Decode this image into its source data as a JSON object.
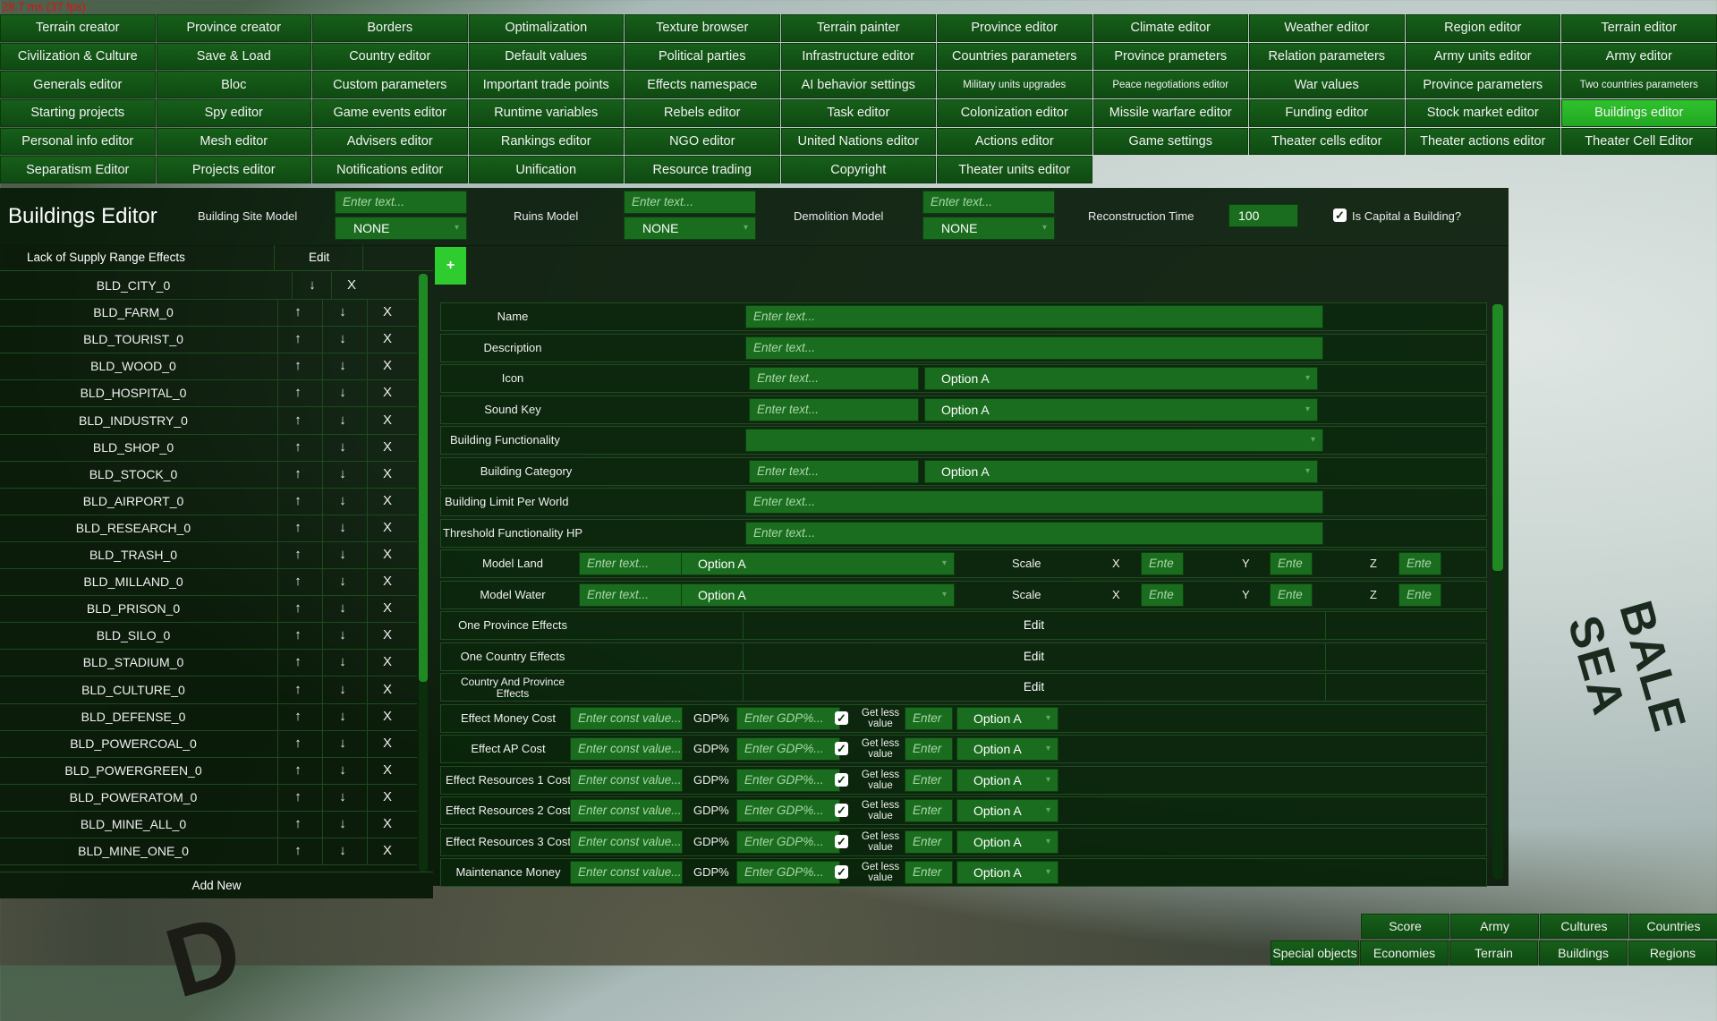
{
  "fps": "28.7 ms (37 fps)",
  "menu": [
    [
      "Terrain creator",
      "Province creator",
      "Borders",
      "Optimalization",
      "Texture browser",
      "Terrain painter",
      "Province editor",
      "Climate editor",
      "Weather editor",
      "Region editor",
      "Terrain editor"
    ],
    [
      "Civilization & Culture",
      "Save & Load",
      "Country editor",
      "Default values",
      "Political parties",
      "Infrastructure editor",
      "Countries parameters",
      "Province prameters",
      "Relation parameters",
      "Army units editor",
      "Army editor"
    ],
    [
      "Generals editor",
      "Bloc",
      "Custom parameters",
      "Important trade points",
      "Effects namespace",
      "AI behavior settings",
      "Military units upgrades",
      "Peace negotiations editor",
      "War values",
      "Province parameters",
      "Two countries parameters"
    ],
    [
      "Starting projects",
      "Spy editor",
      "Game events editor",
      "Runtime variables",
      "Rebels editor",
      "Task editor",
      "Colonization editor",
      "Missile warfare editor",
      "Funding editor",
      "Stock market editor",
      "Buildings editor"
    ],
    [
      "Personal info editor",
      "Mesh editor",
      "Advisers editor",
      "Rankings editor",
      "NGO editor",
      "United Nations editor",
      "Actions editor",
      "Game settings",
      "Theater cells editor",
      "Theater actions editor",
      "Theater Cell Editor"
    ],
    [
      "Separatism Editor",
      "Projects editor",
      "Notifications editor",
      "Unification",
      "Resource trading",
      "Copyright",
      "Theater units editor"
    ]
  ],
  "active_menu": "Buildings editor",
  "editor": {
    "title": "Buildings Editor",
    "building_site_label": "Building Site Model",
    "ruins_label": "Ruins Model",
    "demolition_label": "Demolition Model",
    "reconstruction_label": "Reconstruction Time",
    "reconstruction_value": "100",
    "capital_label": "Is Capital a Building?",
    "capital_checked": true,
    "placeholder": "Enter text...",
    "none_value": "NONE"
  },
  "list": {
    "header_label": "Lack of Supply Range Effects",
    "header_edit": "Edit",
    "add_new": "Add New",
    "up_glyph": "↑",
    "down_glyph": "↓",
    "remove_glyph": "X",
    "items": [
      "BLD_CITY_0",
      "BLD_FARM_0",
      "BLD_TOURIST_0",
      "BLD_WOOD_0",
      "BLD_HOSPITAL_0",
      "BLD_INDUSTRY_0",
      "BLD_SHOP_0",
      "BLD_STOCK_0",
      "BLD_AIRPORT_0",
      "BLD_RESEARCH_0",
      "BLD_TRASH_0",
      "BLD_MILLAND_0",
      "BLD_PRISON_0",
      "BLD_SILO_0",
      "BLD_STADIUM_0",
      "BLD_CULTURE_0",
      "BLD_DEFENSE_0",
      "BLD_POWERCOAL_0",
      "BLD_POWERGREEN_0",
      "BLD_POWERATOM_0",
      "BLD_MINE_ALL_0",
      "BLD_MINE_ONE_0"
    ]
  },
  "form": {
    "plus": "+",
    "placeholder": "Enter text...",
    "short_placeholder": "Ente",
    "option": "Option A",
    "edit": "Edit",
    "scale": "Scale",
    "x": "X",
    "y": "Y",
    "z": "Z",
    "gdp": "GDP%",
    "const_placeholder": "Enter const value...",
    "gdp_placeholder": "Enter GDP%...",
    "enter_short": "Enter",
    "get_less_1": "Get less",
    "get_less_2": "value",
    "fields": {
      "name": "Name",
      "description": "Description",
      "icon": "Icon",
      "sound_key": "Sound Key",
      "functionality": "Building Functionality",
      "category": "Building Category",
      "limit": "Building Limit Per World",
      "threshold": "Threshold Functionality HP",
      "model_land": "Model Land",
      "model_water": "Model Water",
      "one_province": "One Province Effects",
      "one_country": "One Country Effects",
      "country_province_1": "Country And Province",
      "country_province_2": "Effects"
    },
    "costs": [
      "Effect Money Cost",
      "Effect AP Cost",
      "Effect Resources 1 Cost",
      "Effect Resources 2 Cost",
      "Effect Resources 3 Cost",
      "Maintenance Money"
    ]
  },
  "bottom_buttons": {
    "row1": [
      "Score",
      "Army",
      "Cultures",
      "Countries"
    ],
    "row2": [
      "Special objects",
      "Economies",
      "Terrain",
      "Buildings",
      "Regions"
    ]
  },
  "map": {
    "sea_text": "BALE SEA",
    "land_text": "D"
  },
  "colors": {
    "menu_bg": "#175f1a",
    "active": "#2fc22c",
    "input_bg": "#1a6d1e",
    "panel_bg": "#061807"
  }
}
